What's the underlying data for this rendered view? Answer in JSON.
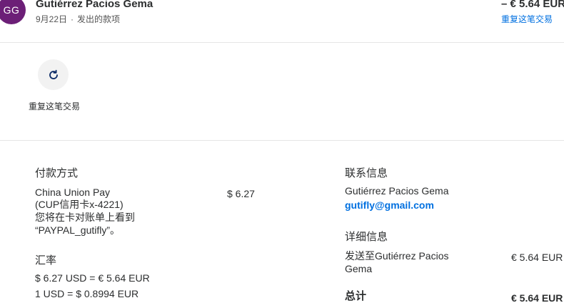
{
  "header": {
    "avatar_initials": "GG",
    "merchant_name": "Gutiérrez Pacios Gema",
    "date": "9月22日",
    "separator": "·",
    "transaction_type": "发出的款项",
    "amount": "– € 5.64 EUR",
    "repeat_link": "重复这笔交易"
  },
  "action": {
    "icon": "refresh-icon",
    "label": "重复这笔交易"
  },
  "payment": {
    "title": "付款方式",
    "method_line1": "China Union Pay",
    "method_line2": "(CUP信用卡x-4221)",
    "statement_line1": "您将在卡对账单上看到",
    "statement_line2": "“PAYPAL_gutifly”。",
    "amount": "$ 6.27"
  },
  "exchange": {
    "title": "汇率",
    "line1": "$ 6.27 USD = € 5.64 EUR",
    "line2": "1 USD = $ 0.8994 EUR"
  },
  "contact": {
    "title": "联系信息",
    "name": "Gutiérrez Pacios Gema",
    "email": "gutifly@gmail.com"
  },
  "details": {
    "title": "详细信息",
    "sent_to_line1": "发送至Gutiérrez Pacios",
    "sent_to_line2": "Gema",
    "sent_amount": "€ 5.64 EUR",
    "total_label": "总计",
    "total_amount": "€ 5.64 EUR"
  },
  "colors": {
    "avatar": "#6c1f77",
    "link": "#0070e0",
    "text": "#2c2e2f"
  }
}
